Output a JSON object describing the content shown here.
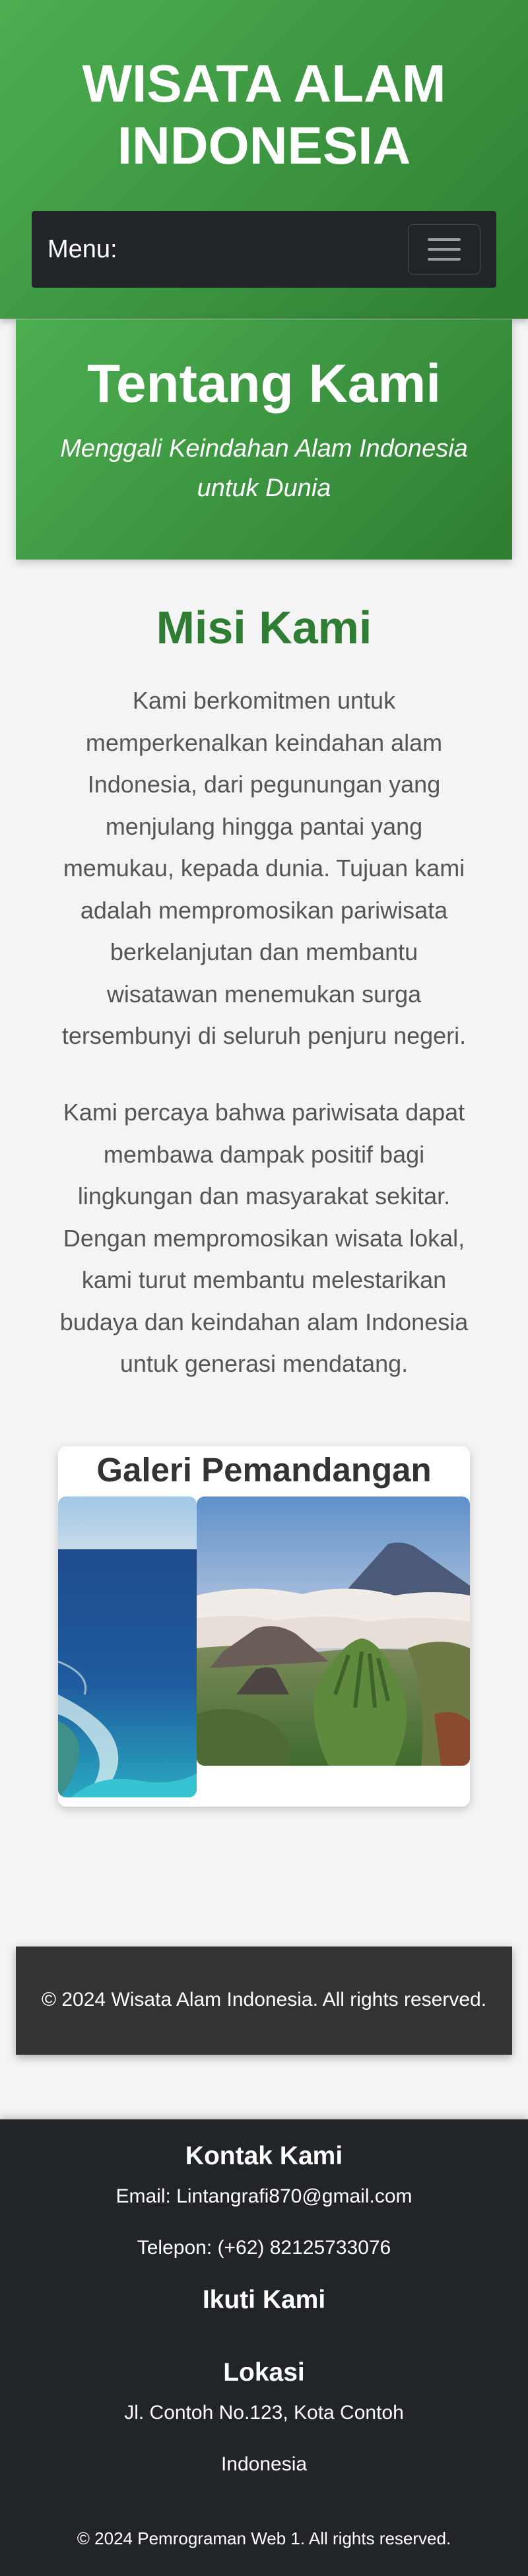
{
  "header": {
    "title_line1": "WISATA ALAM",
    "title_line2": "INDONESIA",
    "nav_label": "Menu:"
  },
  "about": {
    "title": "Tentang Kami",
    "subtitle_line1": "Menggali Keindahan Alam Indonesia",
    "subtitle_line2": "untuk Dunia"
  },
  "mission": {
    "title": "Misi Kami",
    "paragraph1": [
      "Kami berkomitmen untuk",
      "memperkenalkan keindahan alam",
      "Indonesia, dari pegunungan yang",
      "menjulang hingga pantai yang",
      "memukau, kepada dunia. Tujuan kami",
      "adalah mempromosikan pariwisata",
      "berkelanjutan dan membantu",
      "wisatawan menemukan surga",
      "tersembunyi di seluruh penjuru negeri."
    ],
    "paragraph2": [
      "Kami percaya bahwa pariwisata dapat",
      "membawa dampak positif bagi",
      "lingkungan dan masyarakat sekitar.",
      "Dengan mempromosikan wisata lokal,",
      "kami turut membantu melestarikan",
      "budaya dan keindahan alam Indonesia",
      "untuk generasi mendatang."
    ]
  },
  "gallery": {
    "title": "Galeri Pemandangan Alam"
  },
  "copyright_box": {
    "text": "© 2024 Wisata Alam Indonesia. All rights reserved."
  },
  "footer": {
    "contact_heading": "Kontak Kami",
    "email": "Email: Lintangrafi870@gmail.com",
    "phone": "Telepon: (+62) 82125733076",
    "follow_heading": "Ikuti Kami",
    "location_heading": "Lokasi",
    "address_line1": "Jl. Contoh No.123, Kota Contoh",
    "address_line2": "Indonesia",
    "copyright": "© 2024 Pemrograman Web 1. All rights reserved."
  },
  "colors": {
    "primary_green": "#4caf50",
    "dark_green": "#2e7d32",
    "navbar": "#212529",
    "copyright_box": "#333333",
    "page_background": "#f4f4f4"
  }
}
